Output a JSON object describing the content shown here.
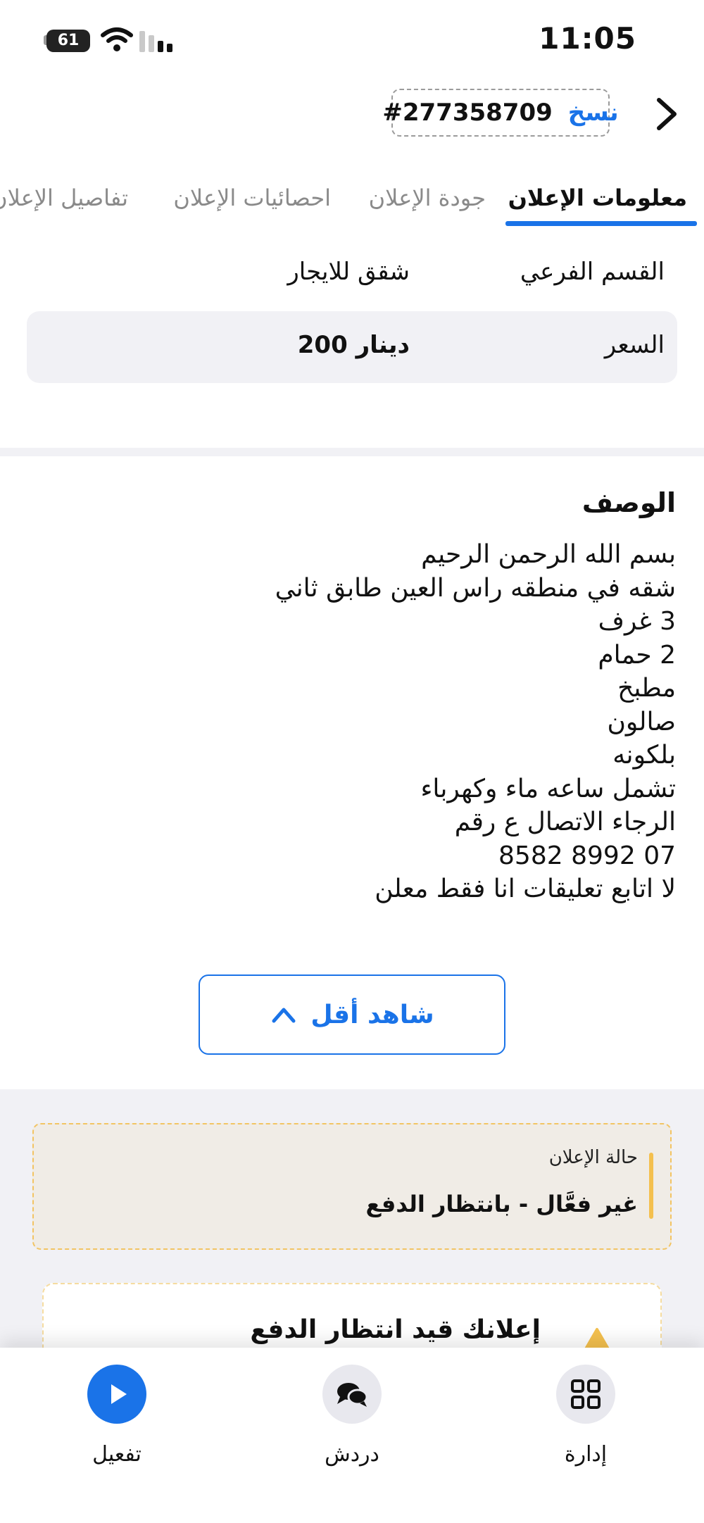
{
  "status_bar": {
    "time": "11:05",
    "battery": "61"
  },
  "header": {
    "copy_label": "نسخ",
    "ad_id": "#277358709"
  },
  "tabs": [
    {
      "label": "معلومات الإعلان",
      "active": true
    },
    {
      "label": "جودة الإعلان"
    },
    {
      "label": "احصائيات الإعلان"
    },
    {
      "label": "تفاصيل الإعلان"
    }
  ],
  "info": {
    "subcategory_label": "القسم الفرعي",
    "subcategory_value": "شقق للايجار",
    "price_label": "السعر",
    "price_value": "200 دينار"
  },
  "description": {
    "title": "الوصف",
    "lines": [
      "بسم الله الرحمن الرحيم",
      "شقه في منطقه راس العين طابق ثاني",
      "3 غرف",
      "2 حمام",
      "مطبخ",
      "صالون",
      "بلكونه",
      "تشمل ساعه ماء وكهرباء",
      "الرجاء الاتصال ع رقم",
      "07 8992 8582",
      "لا اتابع تعليقات انا فقط معلن"
    ],
    "show_less_label": "شاهد أقل"
  },
  "ad_status": {
    "caption": "حالة الإعلان",
    "value": "غير فعَّال - بانتظار الدفع"
  },
  "pending": {
    "title": "إعلانك قيد انتظار الدفع"
  },
  "bottom_nav": [
    {
      "label": "تفعيل",
      "icon": "play-icon",
      "color": "#1a73e8"
    },
    {
      "label": "دردش",
      "icon": "chat-icon",
      "color": "#e8e8ee"
    },
    {
      "label": "إدارة",
      "icon": "grid-icon",
      "color": "#e8e8ee"
    }
  ],
  "colors": {
    "accent": "#1a73e8",
    "status_yellow": "#f4c04e"
  }
}
